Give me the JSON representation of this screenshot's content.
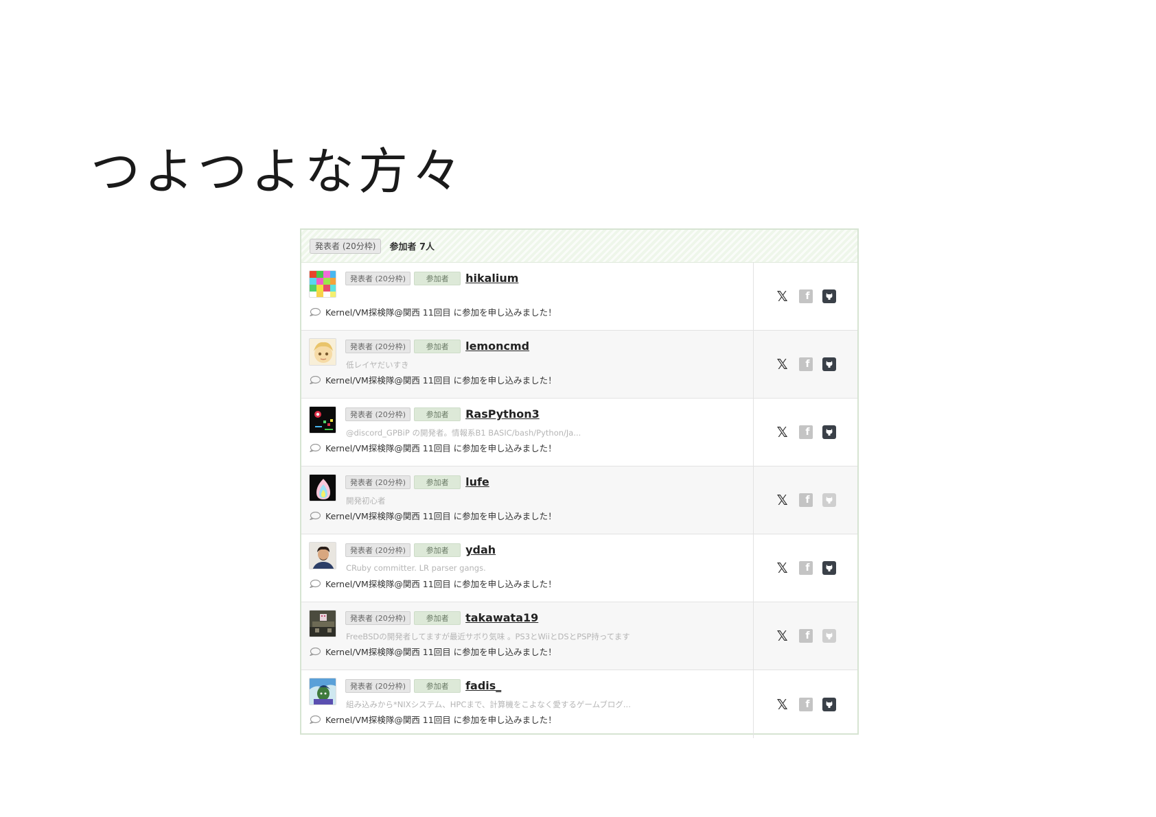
{
  "slide": {
    "title": "つよつよな方々"
  },
  "panel": {
    "header_badge": "発表者 (20分枠)",
    "header_count": "参加者 7人",
    "speaker_badge": "発表者 (20分枠)",
    "attendee_badge": "参加者",
    "activity_text": "Kernel/VM探検隊@関西 11回目 に参加を申し込みました！"
  },
  "participants": [
    {
      "username": "hikalium",
      "bio": "",
      "github_active": true
    },
    {
      "username": "lemoncmd",
      "bio": "低レイヤだいすき",
      "github_active": true
    },
    {
      "username": "RasPython3",
      "bio": "@discord_GPBiP の開発者。情報系B1 BASIC/bash/Python/Ja...",
      "github_active": true
    },
    {
      "username": "lufe",
      "bio": "開発初心者",
      "github_active": false
    },
    {
      "username": "ydah",
      "bio": "CRuby committer. LR parser gangs.",
      "github_active": true
    },
    {
      "username": "takawata19",
      "bio": "FreeBSDの開発者してますが最近サボり気味 。PS3とWiiとDSとPSP持ってます",
      "github_active": false
    },
    {
      "username": "fadis_",
      "bio": "組み込みから*NIXシステム、HPCまで、計算機をこよなく愛するゲームブログ...",
      "github_active": true
    }
  ],
  "icons": {
    "x": "x-logo-icon",
    "facebook": "facebook-icon",
    "github": "github-icon",
    "comment": "comment-bubble-icon"
  },
  "colors": {
    "header_bg": "#eef6ea",
    "attendee_badge_bg": "#dde9d8",
    "github_icon": "#3a4048",
    "facebook_icon": "#c4c4c4"
  }
}
